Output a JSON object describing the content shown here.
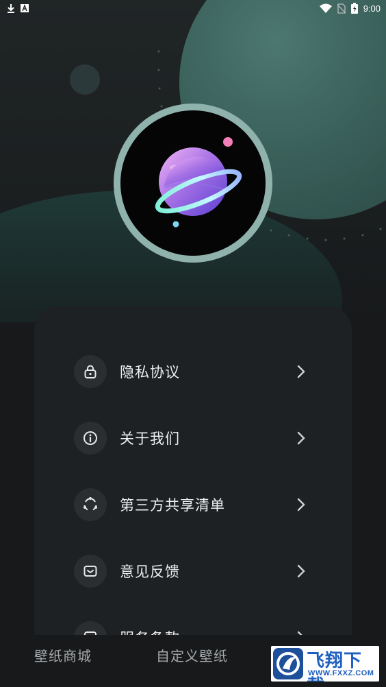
{
  "status_bar": {
    "time": "9:00",
    "left_icons": [
      "download-icon",
      "a-badge-icon"
    ],
    "right_icons": [
      "wifi-icon",
      "no-sim-icon",
      "battery-icon"
    ]
  },
  "header": {
    "app_logo": "planet-icon"
  },
  "menu": {
    "items": [
      {
        "label": "隐私协议",
        "icon": "lock-icon"
      },
      {
        "label": "关于我们",
        "icon": "info-icon"
      },
      {
        "label": "第三方共享清单",
        "icon": "share-circle-icon"
      },
      {
        "label": "意见反馈",
        "icon": "feedback-icon"
      },
      {
        "label": "服务条款",
        "icon": "document-icon"
      }
    ]
  },
  "bottom_nav": {
    "tabs": [
      {
        "label": "壁纸商城"
      },
      {
        "label": "自定义壁纸"
      }
    ]
  },
  "watermark": {
    "title": "飞翔下载",
    "url": "WWW.FXXZ.COM"
  },
  "colors": {
    "background": "#17191b",
    "card": "#1e2123",
    "accent_teal": "#3a605a",
    "avatar_ring": "#8fb2ad"
  }
}
